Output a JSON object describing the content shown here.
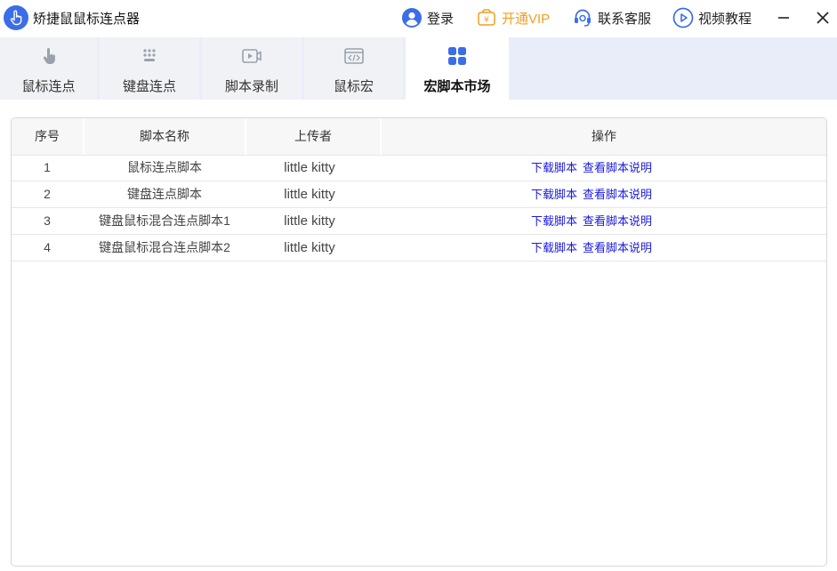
{
  "app": {
    "title": "矫捷鼠鼠标连点器"
  },
  "top_actions": {
    "login": "登录",
    "vip": "开通VIP",
    "support": "联系客服",
    "tutorial": "视频教程"
  },
  "colors": {
    "accent": "#3b6de8",
    "vip": "#f0a020",
    "link": "#1a1adc"
  },
  "tabs": [
    {
      "label": "鼠标连点",
      "icon": "pointer-hand-icon"
    },
    {
      "label": "键盘连点",
      "icon": "keypad-icon"
    },
    {
      "label": "脚本录制",
      "icon": "video-record-icon"
    },
    {
      "label": "鼠标宏",
      "icon": "code-window-icon"
    },
    {
      "label": "宏脚本市场",
      "icon": "grid-apps-icon",
      "active": true
    }
  ],
  "table": {
    "columns": [
      "序号",
      "脚本名称",
      "上传者",
      "操作"
    ],
    "rows": [
      {
        "no": "1",
        "name": "鼠标连点脚本",
        "uploader": "little kitty",
        "download": "下载脚本",
        "view": "查看脚本说明"
      },
      {
        "no": "2",
        "name": "键盘连点脚本",
        "uploader": "little kitty",
        "download": "下载脚本",
        "view": "查看脚本说明"
      },
      {
        "no": "3",
        "name": "键盘鼠标混合连点脚本1",
        "uploader": "little kitty",
        "download": "下载脚本",
        "view": "查看脚本说明"
      },
      {
        "no": "4",
        "name": "键盘鼠标混合连点脚本2",
        "uploader": "little kitty",
        "download": "下载脚本",
        "view": "查看脚本说明"
      }
    ]
  }
}
